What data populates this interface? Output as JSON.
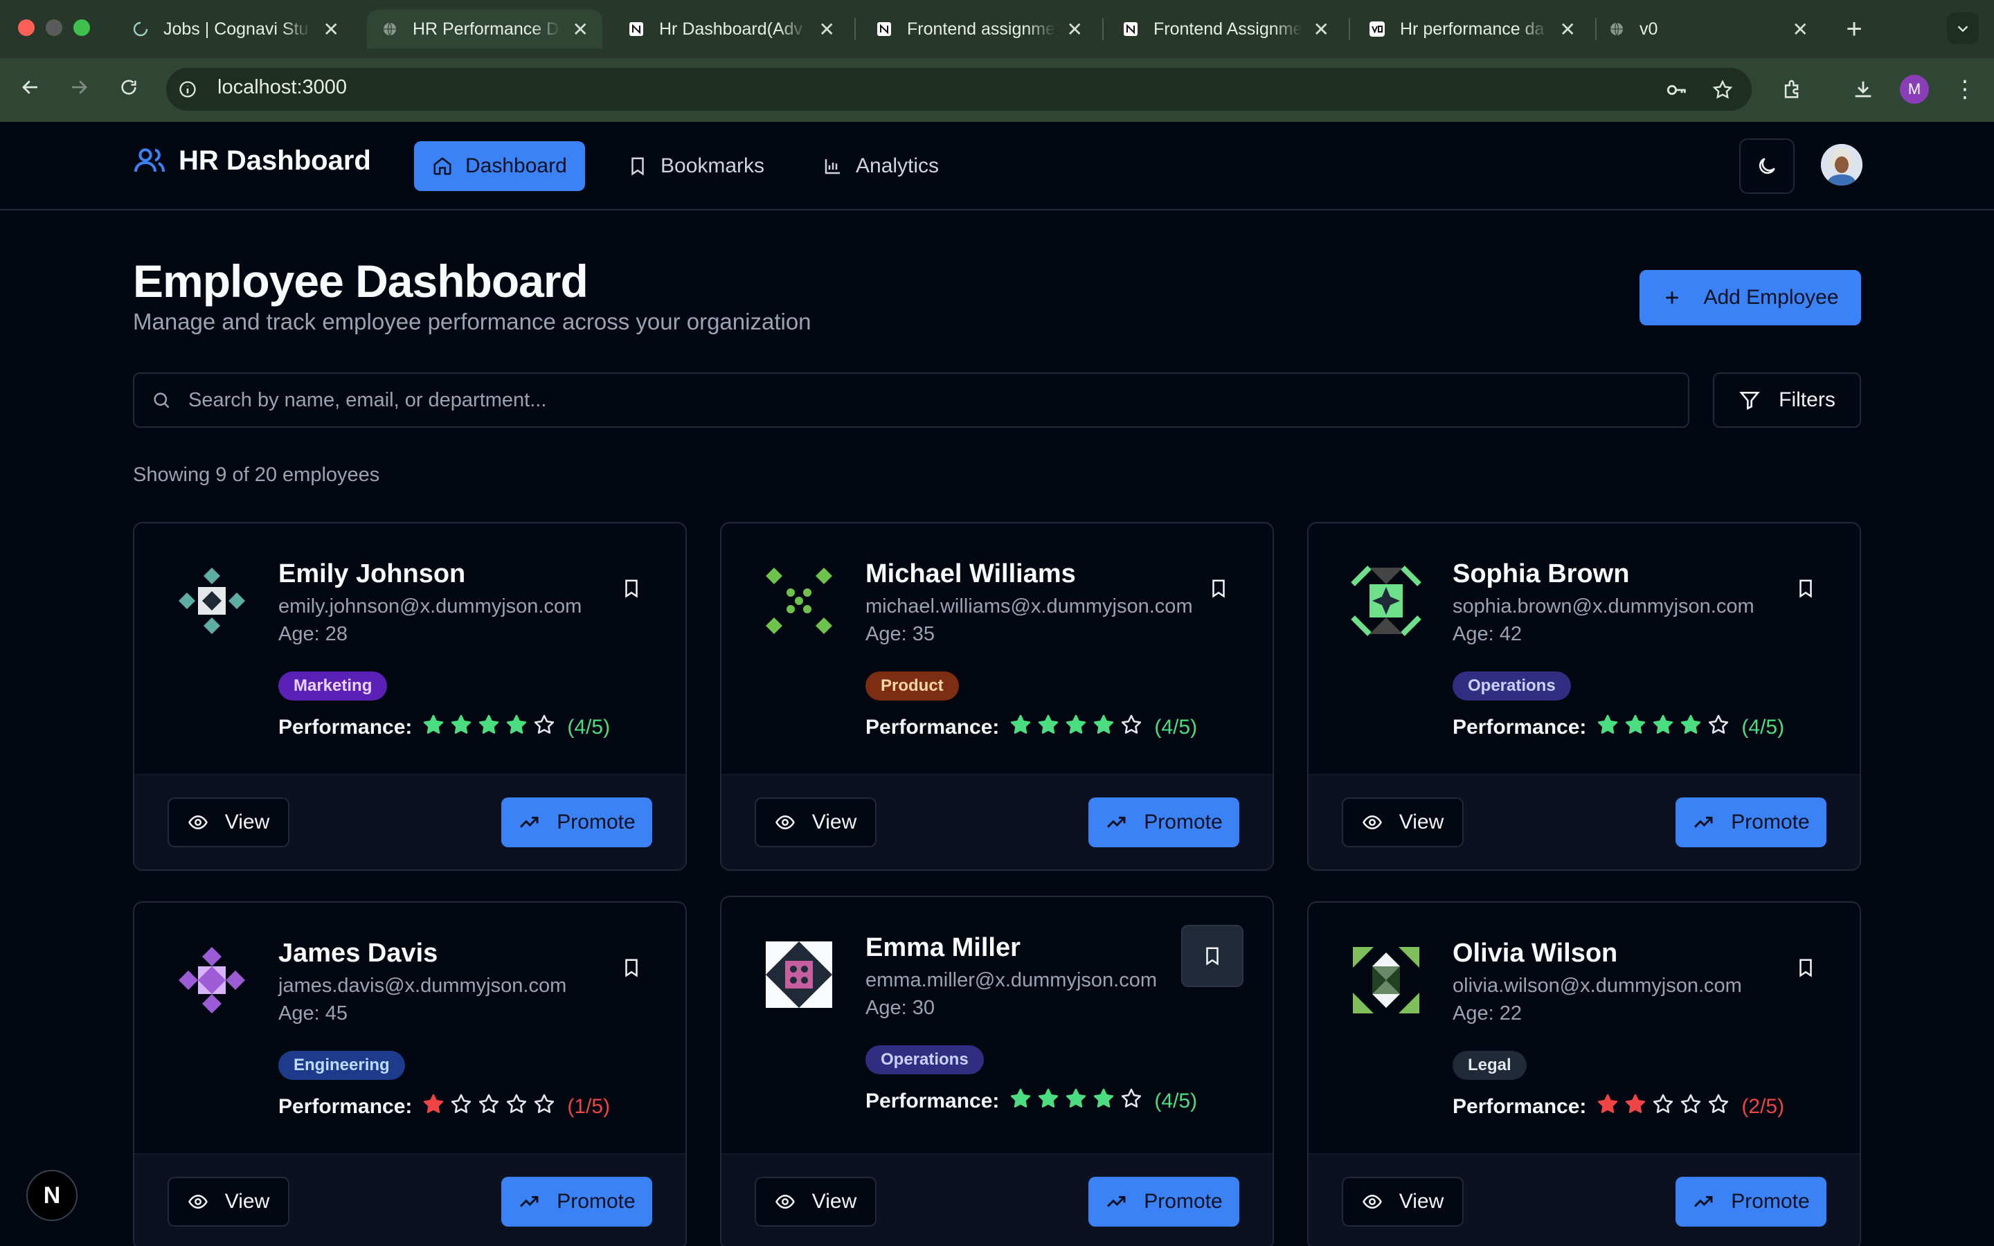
{
  "browser": {
    "tabs": [
      {
        "title": "Jobs | Cognavi Stu",
        "icon": "cognavi-icon",
        "active": false
      },
      {
        "title": "HR Performance Da",
        "icon": "globe-icon",
        "active": true
      },
      {
        "title": "Hr Dashboard(Adv",
        "icon": "notion-icon",
        "active": false
      },
      {
        "title": "Frontend assignme",
        "icon": "notion-icon",
        "active": false
      },
      {
        "title": "Frontend Assignme",
        "icon": "notion-icon",
        "active": false
      },
      {
        "title": "Hr performance da",
        "icon": "v0-icon",
        "active": false
      },
      {
        "title": "v0",
        "icon": "globe-icon",
        "active": false
      }
    ],
    "close_glyph": "✕",
    "new_tab_glyph": "+",
    "url": "localhost:3000",
    "profile_initial": "M"
  },
  "app": {
    "brand": "HR Dashboard",
    "nav": [
      {
        "label": "Dashboard",
        "icon": "home-icon",
        "active": true
      },
      {
        "label": "Bookmarks",
        "icon": "bookmark-icon",
        "active": false
      },
      {
        "label": "Analytics",
        "icon": "bar-chart-icon",
        "active": false
      }
    ],
    "theme_toggle_icon": "moon-icon"
  },
  "page": {
    "title": "Employee Dashboard",
    "subtitle": "Manage and track employee performance across your organization",
    "add_button": "Add Employee",
    "search_placeholder": "Search by name, email, or department...",
    "filters_button": "Filters",
    "count_text": "Showing 9 of 20 employees",
    "perf_label": "Performance:",
    "view_label": "View",
    "promote_label": "Promote"
  },
  "colors": {
    "accent": "#3b82f6",
    "star_good": "#4ade80",
    "star_bad": "#ef4444",
    "background": "#030712",
    "border": "#1f2937"
  },
  "employees": [
    {
      "name": "Emily Johnson",
      "email": "emily.johnson@x.dummyjson.com",
      "age": "Age: 28",
      "department": "Marketing",
      "rating": 4,
      "max": 5,
      "score": "(4/5)",
      "avatar_color": "#5eada3",
      "bookmark_boxed": false
    },
    {
      "name": "Michael Williams",
      "email": "michael.williams@x.dummyjson.com",
      "age": "Age: 35",
      "department": "Product",
      "rating": 4,
      "max": 5,
      "score": "(4/5)",
      "avatar_color": "#6cc24a",
      "bookmark_boxed": false
    },
    {
      "name": "Sophia Brown",
      "email": "sophia.brown@x.dummyjson.com",
      "age": "Age: 42",
      "department": "Operations",
      "rating": 4,
      "max": 5,
      "score": "(4/5)",
      "avatar_color": "#6ee08a",
      "bookmark_boxed": false
    },
    {
      "name": "James Davis",
      "email": "james.davis@x.dummyjson.com",
      "age": "Age: 45",
      "department": "Engineering",
      "rating": 1,
      "max": 5,
      "score": "(1/5)",
      "avatar_color": "#9b5cd6",
      "bookmark_boxed": false
    },
    {
      "name": "Emma Miller",
      "email": "emma.miller@x.dummyjson.com",
      "age": "Age: 30",
      "department": "Operations",
      "rating": 4,
      "max": 5,
      "score": "(4/5)",
      "avatar_color": "#c65fa0",
      "bookmark_boxed": true
    },
    {
      "name": "Olivia Wilson",
      "email": "olivia.wilson@x.dummyjson.com",
      "age": "Age: 22",
      "department": "Legal",
      "rating": 2,
      "max": 5,
      "score": "(2/5)",
      "avatar_color": "#7fbf5a",
      "bookmark_boxed": false
    }
  ],
  "dev_badge": "N"
}
